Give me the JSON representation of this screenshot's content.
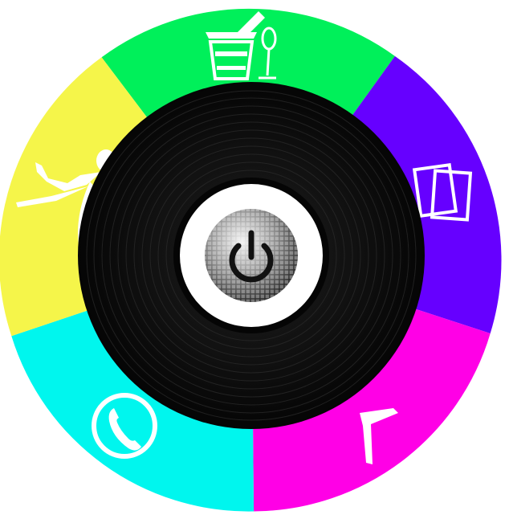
{
  "menu": {
    "segments": [
      {
        "id": "drinks",
        "icon": "champagne-bucket-icon",
        "color": "#00f05a"
      },
      {
        "id": "gallery",
        "icon": "photo-frames-icon",
        "color": "#6600ff"
      },
      {
        "id": "music",
        "icon": "music-note-icon",
        "color": "#ff00e6"
      },
      {
        "id": "contact",
        "icon": "phone-icon",
        "color": "#00f6ee"
      },
      {
        "id": "dance",
        "icon": "dancer-icon",
        "color": "#f5f54a"
      }
    ]
  },
  "center": {
    "record_color": "#0c0c0c",
    "label_color": "#ffffff",
    "icon": "disco-ball-power-icon"
  }
}
